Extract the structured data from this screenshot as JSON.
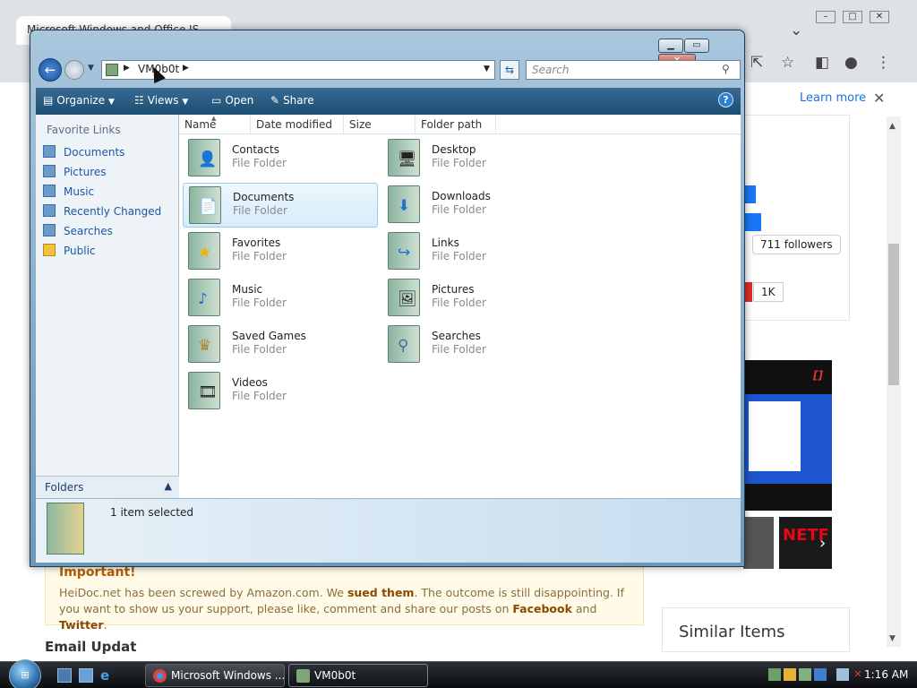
{
  "browser": {
    "tab_title": "Microsoft Windows and Office IS",
    "learn_more": "Learn more",
    "followers": "711 followers",
    "likes": "1K",
    "notice_title": "Important!",
    "notice_pre": "HeiDoc.net has been screwed by Amazon.com. We ",
    "notice_sued": "sued them",
    "notice_mid": ". The outcome is still disappointing. If you want to show us your support, please like, comment and share our posts on ",
    "notice_facebook": "Facebook",
    "notice_and": " and ",
    "notice_twitter": "Twitter",
    "notice_end": ".",
    "similar_items": "Similar Items",
    "email_updates": "Email Updat"
  },
  "explorer": {
    "address_crumb": "VM0b0t",
    "search_placeholder": "Search",
    "toolbar": {
      "organize": "Organize",
      "views": "Views",
      "open": "Open",
      "share": "Share"
    },
    "favorite_links_title": "Favorite Links",
    "favorite_links": [
      "Documents",
      "Pictures",
      "Music",
      "Recently Changed",
      "Searches",
      "Public"
    ],
    "folders_label": "Folders",
    "columns": [
      "Name",
      "Date modified",
      "Size",
      "Folder path"
    ],
    "items": [
      {
        "name": "Contacts",
        "type": "File Folder",
        "icon": "contacts-folder-icon"
      },
      {
        "name": "Desktop",
        "type": "File Folder",
        "icon": "desktop-folder-icon"
      },
      {
        "name": "Documents",
        "type": "File Folder",
        "icon": "documents-folder-icon",
        "selected": true
      },
      {
        "name": "Downloads",
        "type": "File Folder",
        "icon": "downloads-folder-icon"
      },
      {
        "name": "Favorites",
        "type": "File Folder",
        "icon": "favorites-folder-icon"
      },
      {
        "name": "Links",
        "type": "File Folder",
        "icon": "links-folder-icon"
      },
      {
        "name": "Music",
        "type": "File Folder",
        "icon": "music-folder-icon"
      },
      {
        "name": "Pictures",
        "type": "File Folder",
        "icon": "pictures-folder-icon"
      },
      {
        "name": "Saved Games",
        "type": "File Folder",
        "icon": "saved-games-folder-icon"
      },
      {
        "name": "Searches",
        "type": "File Folder",
        "icon": "searches-folder-icon"
      },
      {
        "name": "Videos",
        "type": "File Folder",
        "icon": "videos-folder-icon"
      }
    ],
    "status": "1 item selected"
  },
  "taskbar": {
    "tasks": [
      {
        "label": "Microsoft Windows ...",
        "icon": "chrome-icon"
      },
      {
        "label": "VM0b0t",
        "icon": "folder-icon"
      }
    ],
    "clock": "1:16 AM"
  },
  "colors": {
    "link_blue": "#1c58a5",
    "toolbar_dark": "#1b4d72",
    "selection": "#d6ecfb"
  }
}
